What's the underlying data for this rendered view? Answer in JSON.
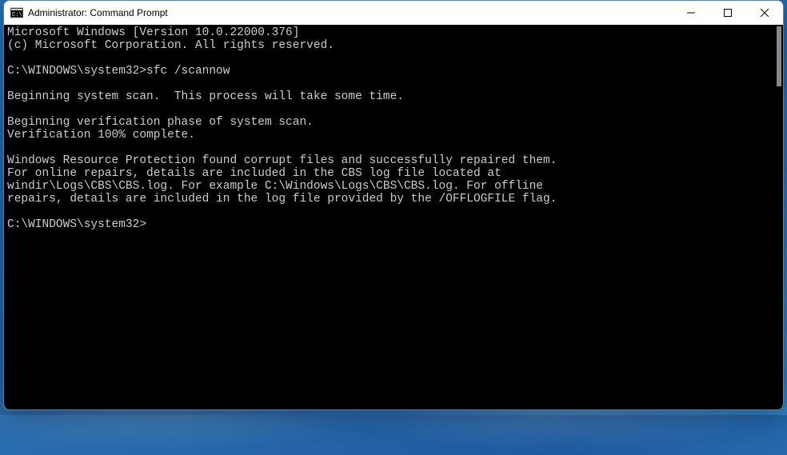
{
  "window": {
    "title": "Administrator: Command Prompt"
  },
  "terminal": {
    "lines": [
      "Microsoft Windows [Version 10.0.22000.376]",
      "(c) Microsoft Corporation. All rights reserved.",
      "",
      "C:\\WINDOWS\\system32>sfc /scannow",
      "",
      "Beginning system scan.  This process will take some time.",
      "",
      "Beginning verification phase of system scan.",
      "Verification 100% complete.",
      "",
      "Windows Resource Protection found corrupt files and successfully repaired them.",
      "For online repairs, details are included in the CBS log file located at",
      "windir\\Logs\\CBS\\CBS.log. For example C:\\Windows\\Logs\\CBS\\CBS.log. For offline",
      "repairs, details are included in the log file provided by the /OFFLOGFILE flag.",
      "",
      "C:\\WINDOWS\\system32>"
    ],
    "prompt_path": "C:\\WINDOWS\\system32",
    "command": "sfc /scannow",
    "verification_percent": 100
  }
}
